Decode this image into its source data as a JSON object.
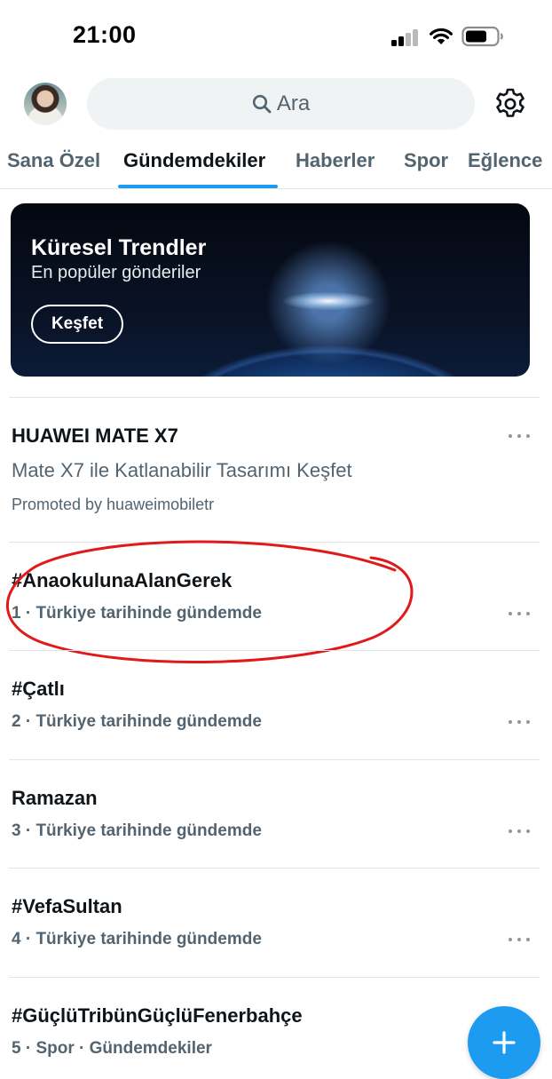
{
  "status_bar": {
    "time": "21:00"
  },
  "header": {
    "search_placeholder": "Ara"
  },
  "tabs": [
    {
      "label": "Sana Özel",
      "active": false
    },
    {
      "label": "Gündemdekiler",
      "active": true
    },
    {
      "label": "Haberler",
      "active": false
    },
    {
      "label": "Spor",
      "active": false
    },
    {
      "label": "Eğlence",
      "active": false
    }
  ],
  "banner": {
    "title": "Küresel Trendler",
    "subtitle": "En popüler gönderiler",
    "button": "Keşfet"
  },
  "promoted": {
    "title": "HUAWEI MATE X7",
    "description": "Mate X7 ile Katlanabilir Tasarımı Keşfet",
    "byline": "Promoted by huaweimobiletr"
  },
  "trends": [
    {
      "title": "#AnaokulunaAlanGerek",
      "meta": "1 · Türkiye tarihinde gündemde"
    },
    {
      "title": "#Çatlı",
      "meta": "2 · Türkiye tarihinde gündemde"
    },
    {
      "title": "Ramazan",
      "meta": "3 · Türkiye tarihinde gündemde"
    },
    {
      "title": "#VefaSultan",
      "meta": "4 · Türkiye tarihinde gündemde"
    },
    {
      "title": "#GüçlüTribünGüçlüFenerbahçe",
      "meta": "5 · Spor · Gündemdekiler"
    }
  ],
  "colors": {
    "accent": "#1d9bf0",
    "secondary_text": "#536471",
    "annotation": "#e0191b"
  }
}
